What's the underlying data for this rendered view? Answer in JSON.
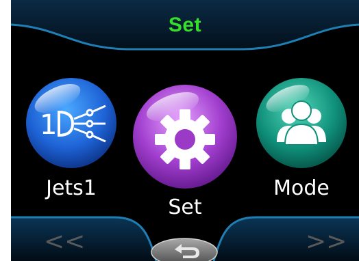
{
  "header": {
    "title": "Set"
  },
  "menu": {
    "items": [
      {
        "label": "Jets1",
        "icon": "jets-1-icon",
        "color": "#1e63d6"
      },
      {
        "label": "Set",
        "icon": "gear-icon",
        "color": "#a23fcf",
        "selected": true
      },
      {
        "label": "Mode",
        "icon": "users-icon",
        "color": "#0f8f79"
      }
    ]
  },
  "nav": {
    "prev_label": "<<",
    "next_label": ">>",
    "back_icon": "return-arrow-icon"
  },
  "colors": {
    "title_green": "#35e02a",
    "frame_blue": "#1f7fb5"
  }
}
